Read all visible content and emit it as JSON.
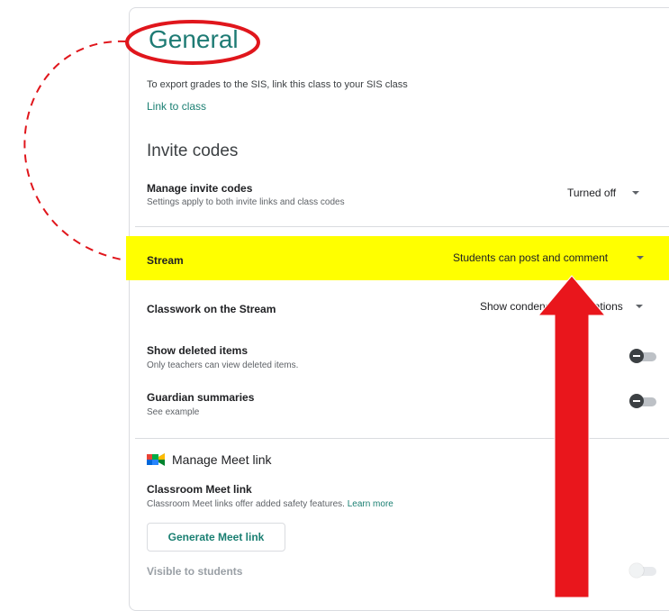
{
  "general": {
    "title": "General",
    "export_desc": "To export grades to the SIS, link this class to your SIS class",
    "link_label": "Link to class"
  },
  "invite_codes": {
    "heading": "Invite codes",
    "manage_label": "Manage invite codes",
    "manage_sub": "Settings apply to both invite links and class codes",
    "manage_value": "Turned off"
  },
  "stream": {
    "label": "Stream",
    "value": "Students can post and comment"
  },
  "classwork_stream": {
    "label": "Classwork on the Stream",
    "value": "Show condensed notifications"
  },
  "deleted_items": {
    "label": "Show deleted items",
    "sub": "Only teachers can view deleted items."
  },
  "guardian": {
    "label": "Guardian summaries",
    "link": "See example"
  },
  "meet": {
    "heading": "Manage Meet link",
    "label": "Classroom Meet link",
    "sub": "Classroom Meet links offer added safety features.",
    "learn_more": "Learn more",
    "button": "Generate Meet link",
    "visible_label": "Visible to students"
  },
  "colors": {
    "highlight": "#ffff00",
    "annotation": "#e0161c",
    "accent": "#1a7f72"
  }
}
